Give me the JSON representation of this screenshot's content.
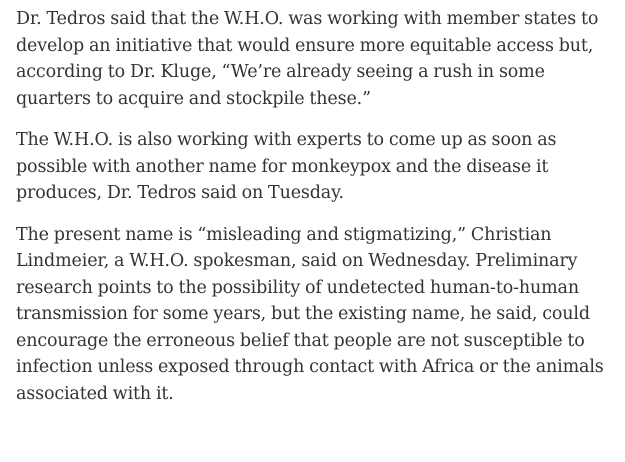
{
  "article": {
    "paragraphs": [
      {
        "lines": [
          "Dr. Tedros said that the W.H.O. was working with member states to",
          "develop an initiative that would ensure more equitable access but,",
          "according to Dr. Kluge, “We’re already seeing a rush in some",
          "quarters to acquire and stockpile these.”"
        ]
      },
      {
        "lines": [
          "The W.H.O. is also working with experts to come up as soon as",
          "possible with another name for monkeypox and the disease it",
          "produces, Dr. Tedros said on Tuesday."
        ]
      },
      {
        "lines": [
          "The present name is “misleading and stigmatizing,” Christian",
          "Lindmeier, a W.H.O. spokesman, said on Wednesday. Preliminary",
          "research points to the possibility of undetected human-to-human",
          "transmission for some years, but the existing name, he said, could",
          "encourage the erroneous belief that people are not susceptible to",
          "infection unless exposed through contact with Africa or the animals",
          "associated with it."
        ]
      }
    ]
  }
}
